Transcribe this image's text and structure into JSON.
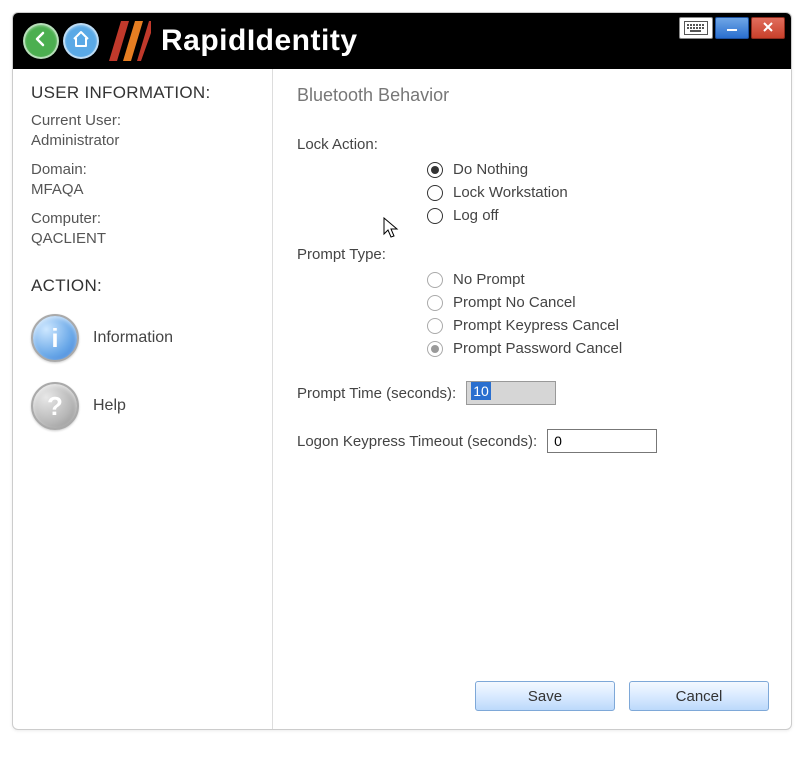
{
  "header": {
    "app_title": "RapidIdentity"
  },
  "sidebar": {
    "user_info_title": "USER INFORMATION:",
    "current_user_label": "Current User:",
    "current_user_value": "Administrator",
    "domain_label": "Domain:",
    "domain_value": "MFAQA",
    "computer_label": "Computer:",
    "computer_value": "QACLIENT",
    "action_title": "ACTION:",
    "actions": [
      {
        "label": "Information"
      },
      {
        "label": "Help"
      }
    ]
  },
  "main": {
    "panel_title": "Bluetooth Behavior",
    "lock_action_label": "Lock Action:",
    "lock_action_options": [
      {
        "label": "Do Nothing",
        "selected": true
      },
      {
        "label": "Lock Workstation",
        "selected": false
      },
      {
        "label": "Log off",
        "selected": false
      }
    ],
    "prompt_type_label": "Prompt Type:",
    "prompt_type_options": [
      {
        "label": "No Prompt",
        "selected": false
      },
      {
        "label": "Prompt No Cancel",
        "selected": false
      },
      {
        "label": "Prompt Keypress Cancel",
        "selected": false
      },
      {
        "label": "Prompt Password Cancel",
        "selected": true
      }
    ],
    "prompt_time_label": "Prompt Time (seconds):",
    "prompt_time_value": "10",
    "logon_timeout_label": "Logon Keypress Timeout (seconds):",
    "logon_timeout_value": "0",
    "save_label": "Save",
    "cancel_label": "Cancel"
  }
}
